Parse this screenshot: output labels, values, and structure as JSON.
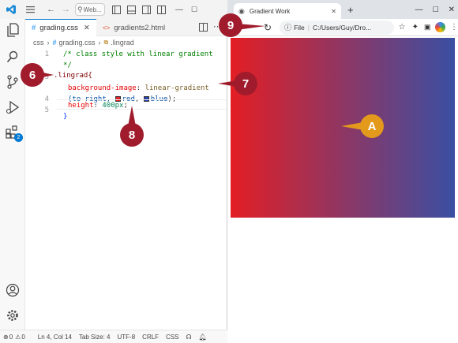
{
  "vscode": {
    "title_search": "Web...",
    "tabs": [
      {
        "label": "grading.css",
        "icon": "#"
      },
      {
        "label": "gradients2.html",
        "icon": "<>"
      }
    ],
    "breadcrumb": [
      "css",
      "#",
      "grading.css",
      ".lingrad"
    ],
    "line_numbers": [
      "1",
      "",
      "2",
      "3",
      "",
      "4",
      "5"
    ],
    "code": {
      "comment1": "/* class style with linear gradient",
      "comment2": "*/",
      "selector": ".lingrad{",
      "prop1": "background-image",
      "colon1": ": ",
      "func1": "linear-gradient",
      "paren_open": "(to right, ",
      "color1": "red",
      "comma": ", ",
      "color2": "blue",
      "paren_close": ");",
      "prop2": "height",
      "colon2": ": ",
      "value2": "400px",
      "semi2": ";",
      "close": "}"
    },
    "status": {
      "errors": "0",
      "warnings": "0",
      "position": "Ln 4, Col 14",
      "tab_size": "Tab Size: 4",
      "encoding": "UTF-8",
      "eol": "CRLF",
      "language": "CSS"
    },
    "extensions_badge": "2"
  },
  "browser": {
    "tab_title": "Gradient Work",
    "address_scheme": "File",
    "address": "C:/Users/Guy/Dro...",
    "gradient_colors": [
      "#e31e24",
      "#3a4fa3"
    ]
  },
  "callouts": {
    "c6": "6",
    "c7": "7",
    "c8": "8",
    "c9": "9",
    "cA": "A"
  }
}
